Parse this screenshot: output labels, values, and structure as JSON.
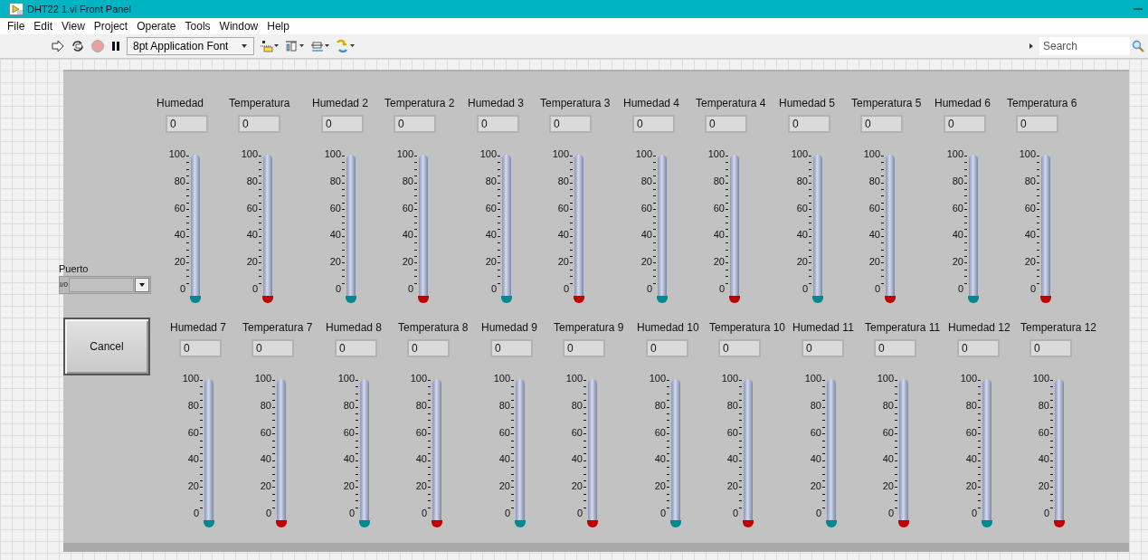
{
  "window": {
    "title": "DHT22 1.vi Front Panel"
  },
  "menu": [
    "File",
    "Edit",
    "View",
    "Project",
    "Operate",
    "Tools",
    "Window",
    "Help"
  ],
  "toolbar": {
    "font": "8pt Application Font",
    "search": {
      "placeholder": "Search"
    }
  },
  "port": {
    "label": "Puerto",
    "prefix": "I/0"
  },
  "cancel": "Cancel",
  "rows": [
    {
      "groups": [
        {
          "gauges": [
            {
              "label": "Humedad",
              "value": "0",
              "level": 0,
              "color": "#008a8f",
              "ticks": [
                "100",
                "80",
                "60",
                "40",
                "20",
                "0"
              ]
            },
            {
              "label": "Temperatura",
              "value": "0",
              "level": 0,
              "color": "#c00000",
              "ticks": [
                "100",
                "80",
                "60",
                "40",
                "20",
                "0"
              ]
            }
          ]
        },
        {
          "gauges": [
            {
              "label": "Humedad 2",
              "value": "0",
              "level": 0,
              "color": "#008a8f",
              "ticks": [
                "100",
                "80",
                "60",
                "40",
                "20",
                "0"
              ]
            },
            {
              "label": "Temperatura 2",
              "value": "0",
              "level": 0,
              "color": "#c00000",
              "ticks": [
                "100",
                "80",
                "60",
                "40",
                "20",
                "0"
              ]
            }
          ]
        },
        {
          "gauges": [
            {
              "label": "Humedad 3",
              "value": "0",
              "level": 0,
              "color": "#008a8f",
              "ticks": [
                "100",
                "80",
                "60",
                "40",
                "20",
                "0"
              ]
            },
            {
              "label": "Temperatura 3",
              "value": "0",
              "level": 0,
              "color": "#c00000",
              "ticks": [
                "100",
                "80",
                "60",
                "40",
                "20",
                "0"
              ]
            }
          ]
        },
        {
          "gauges": [
            {
              "label": "Humedad 4",
              "value": "0",
              "level": 0,
              "color": "#008a8f",
              "ticks": [
                "100",
                "80",
                "60",
                "40",
                "20",
                "0"
              ]
            },
            {
              "label": "Temperatura 4",
              "value": "0",
              "level": 0,
              "color": "#c00000",
              "ticks": [
                "100",
                "80",
                "60",
                "40",
                "20",
                "0"
              ]
            }
          ]
        },
        {
          "gauges": [
            {
              "label": "Humedad 5",
              "value": "0",
              "level": 0,
              "color": "#008a8f",
              "ticks": [
                "100",
                "80",
                "60",
                "40",
                "20",
                "0"
              ]
            },
            {
              "label": "Temperatura 5",
              "value": "0",
              "level": 0,
              "color": "#c00000",
              "ticks": [
                "100",
                "80",
                "60",
                "40",
                "20",
                "0"
              ]
            }
          ]
        },
        {
          "gauges": [
            {
              "label": "Humedad 6",
              "value": "0",
              "level": 0,
              "color": "#008a8f",
              "ticks": [
                "100",
                "80",
                "60",
                "40",
                "20",
                "0"
              ]
            },
            {
              "label": "Temperatura 6",
              "value": "0",
              "level": 0,
              "color": "#c00000",
              "ticks": [
                "100",
                "80",
                "60",
                "40",
                "20",
                "0"
              ]
            }
          ]
        }
      ]
    },
    {
      "groups": [
        {
          "gauges": [
            {
              "label": "Humedad 7",
              "value": "0",
              "level": 0,
              "color": "#008a8f",
              "ticks": [
                "100",
                "80",
                "60",
                "40",
                "20",
                "0"
              ]
            },
            {
              "label": "Temperatura 7",
              "value": "0",
              "level": 0,
              "color": "#c00000",
              "ticks": [
                "100",
                "80",
                "60",
                "40",
                "20",
                "0"
              ]
            }
          ]
        },
        {
          "gauges": [
            {
              "label": "Humedad 8",
              "value": "0",
              "level": 0,
              "color": "#008a8f",
              "ticks": [
                "100",
                "80",
                "60",
                "40",
                "20",
                "0"
              ]
            },
            {
              "label": "Temperatura 8",
              "value": "0",
              "level": 0,
              "color": "#c00000",
              "ticks": [
                "100",
                "80",
                "60",
                "40",
                "20",
                "0"
              ]
            }
          ]
        },
        {
          "gauges": [
            {
              "label": "Humedad 9",
              "value": "0",
              "level": 0,
              "color": "#008a8f",
              "ticks": [
                "100",
                "80",
                "60",
                "40",
                "20",
                "0"
              ]
            },
            {
              "label": "Temperatura 9",
              "value": "0",
              "level": 0,
              "color": "#c00000",
              "ticks": [
                "100",
                "80",
                "60",
                "40",
                "20",
                "0"
              ]
            }
          ]
        },
        {
          "gauges": [
            {
              "label": "Humedad 10",
              "value": "0",
              "level": 0,
              "color": "#008a8f",
              "ticks": [
                "100",
                "80",
                "60",
                "40",
                "20",
                "0"
              ]
            },
            {
              "label": "Temperatura 10",
              "value": "0",
              "level": 0,
              "color": "#c00000",
              "ticks": [
                "100",
                "80",
                "60",
                "40",
                "20",
                "0"
              ]
            }
          ]
        },
        {
          "gauges": [
            {
              "label": "Humedad 11",
              "value": "0",
              "level": 0,
              "color": "#008a8f",
              "ticks": [
                "100",
                "80",
                "60",
                "40",
                "20",
                "0"
              ]
            },
            {
              "label": "Temperatura 11",
              "value": "0",
              "level": 0,
              "color": "#c00000",
              "ticks": [
                "100",
                "80",
                "60",
                "40",
                "20",
                "0"
              ]
            }
          ]
        },
        {
          "gauges": [
            {
              "label": "Humedad 12",
              "value": "0",
              "level": 0,
              "color": "#008a8f",
              "ticks": [
                "100",
                "80",
                "60",
                "40",
                "20",
                "0"
              ]
            },
            {
              "label": "Temperatura 12",
              "value": "0",
              "level": 0,
              "color": "#c00000",
              "ticks": [
                "100",
                "80",
                "60",
                "40",
                "20",
                "0"
              ]
            }
          ]
        }
      ]
    }
  ]
}
